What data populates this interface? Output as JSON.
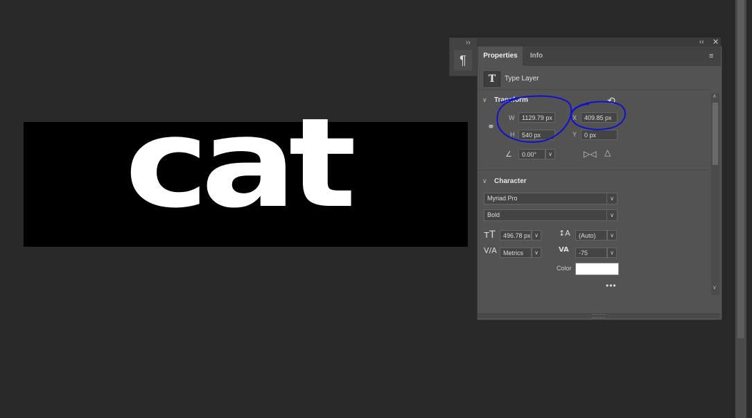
{
  "canvas": {
    "text": "cat"
  },
  "dock": {
    "paragraph_glyph": "¶",
    "expand_glyph": "››"
  },
  "panel": {
    "collapse_glyph": "‹‹",
    "close_glyph": "✕",
    "menu_glyph": "≡",
    "tabs": [
      {
        "label": "Properties",
        "active": true
      },
      {
        "label": "Info",
        "active": false
      }
    ],
    "layer_type_glyph": "T",
    "layer_type_label": "Type Layer",
    "transform": {
      "title": "Transform",
      "w_label": "W",
      "w_value": "1129.79 px",
      "h_label": "H",
      "h_value": "540 px",
      "x_label": "X",
      "x_value": "409.85 px",
      "y_label": "Y",
      "y_value": "0 px",
      "angle_value": "0.00°"
    },
    "character": {
      "title": "Character",
      "font_family": "Myriad Pro",
      "font_style": "Bold",
      "font_size": "496.78 px",
      "leading": "(Auto)",
      "kerning": "Metrics",
      "tracking": "-75",
      "color_label": "Color",
      "color_value": "#ffffff"
    }
  },
  "annotation": {
    "color": "#1010d0"
  },
  "icons": [
    "paragraph-icon",
    "type-icon",
    "reset-icon",
    "link-icon",
    "angle-icon",
    "flip-horizontal-icon",
    "flip-vertical-icon",
    "font-size-icon",
    "leading-icon",
    "kerning-icon",
    "tracking-icon",
    "more-icon"
  ]
}
